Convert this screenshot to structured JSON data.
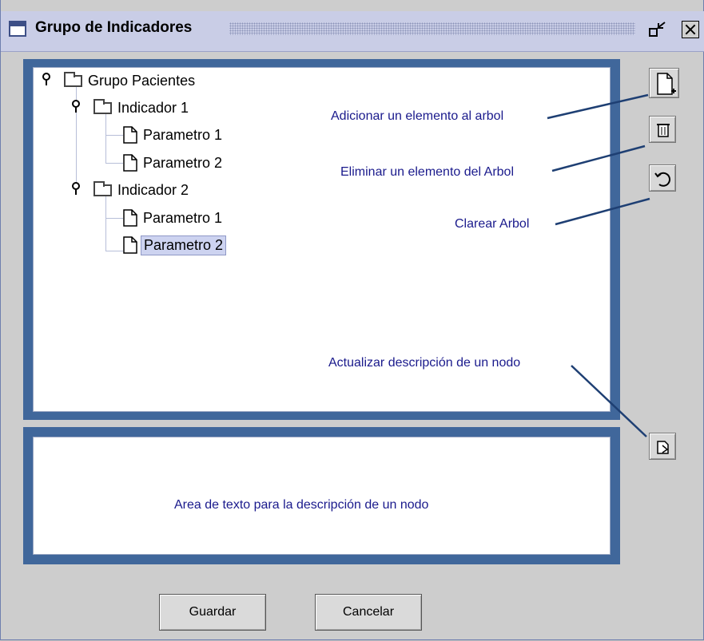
{
  "window": {
    "title": "Grupo de Indicadores",
    "window_icon": "window-icon",
    "minimize_icon": "minimize-icon",
    "close_icon": "close-icon"
  },
  "tree": {
    "root": {
      "label": "Grupo Pacientes",
      "icon": "folder-icon",
      "children": [
        {
          "label": "Indicador 1",
          "icon": "folder-icon",
          "children": [
            {
              "label": "Parametro 1",
              "icon": "document-icon"
            },
            {
              "label": "Parametro 2",
              "icon": "document-icon"
            }
          ]
        },
        {
          "label": "Indicador 2",
          "icon": "folder-icon",
          "children": [
            {
              "label": "Parametro 1",
              "icon": "document-icon"
            },
            {
              "label": "Parametro 2",
              "icon": "document-icon",
              "selected": true
            }
          ]
        }
      ]
    }
  },
  "annotations": {
    "add": "Adicionar un elemento al arbol",
    "delete": "Eliminar un elemento del Arbol",
    "clear": "Clarear Arbol",
    "update": "Actualizar descripción de un nodo"
  },
  "side_buttons": {
    "add_icon": "new-document-icon",
    "delete_icon": "trash-icon",
    "clear_icon": "refresh-icon",
    "update_icon": "edit-document-icon"
  },
  "description": {
    "placeholder": "Area de texto para la descripción de un nodo"
  },
  "buttons": {
    "save": "Guardar",
    "cancel": "Cancelar"
  },
  "colors": {
    "panel_border": "#40679b",
    "annotation_text": "#1a1a8c",
    "selection_bg": "#cdd3f0"
  }
}
